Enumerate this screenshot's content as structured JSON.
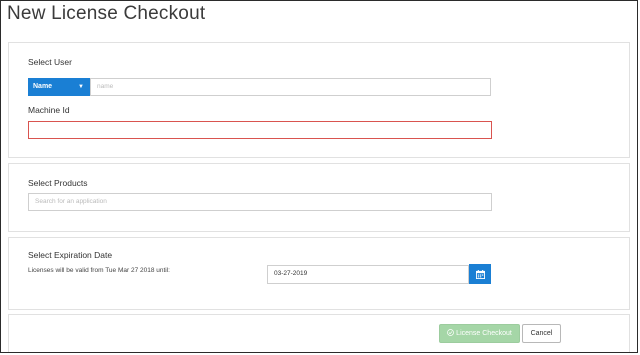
{
  "page": {
    "title": "New License Checkout"
  },
  "user_section": {
    "label": "Select User",
    "search_type": "Name",
    "search_placeholder": "name",
    "machine_label": "Machine Id",
    "machine_value": ""
  },
  "products_section": {
    "label": "Select Products",
    "search_placeholder": "Search for an application"
  },
  "expiration_section": {
    "label": "Select Expiration Date",
    "validity_text": "Licenses will be valid from Tue Mar 27 2018 until:",
    "date_value": "03-27-2019"
  },
  "footer": {
    "checkout_label": "License Checkout",
    "cancel_label": "Cancel"
  },
  "colors": {
    "accent": "#1a7fd4",
    "error": "#d9534f",
    "success_disabled": "#a5d6a7"
  }
}
